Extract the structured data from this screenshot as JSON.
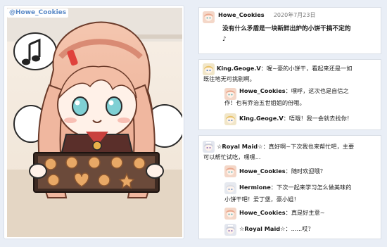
{
  "post": {
    "tag": "@Howe_Cookies"
  },
  "thread1": {
    "author": "Howe_Cookies",
    "date": "2020年7月23日",
    "text_line1": "没有什么矛盾是一块新鲜出炉的小饼干搞不定的",
    "text_line2": "♪"
  },
  "thread2": {
    "comment": {
      "author": "King.Geoge.V",
      "sep": "：",
      "text_line1": "喔~豪的小饼干，看起来还是一如",
      "text_line2": "既往地无可挑剔啊。"
    },
    "replies": [
      {
        "author": "Howe_Cookies",
        "sep": "：",
        "text_line1": "嘿呼，这次也是自信之",
        "text_line2": "作！也有乔治五世姐姐的份哦。"
      },
      {
        "author": "King.Geoge.V",
        "sep": "：",
        "text_line1": "唔哦！我一会就去找你！",
        "text_line2": ""
      }
    ]
  },
  "thread3": {
    "comment": {
      "author": "☆Royal Maid☆",
      "sep": "：",
      "text_line1": "真好啊~下次我也来帮忙吧，主要",
      "text_line2": "可以帮忙试吃，嘿嘿..."
    },
    "replies": [
      {
        "author": "Howe_Cookies",
        "sep": "：",
        "text_line1": "随时欢迎哦？",
        "text_line2": ""
      },
      {
        "author": "Hermione",
        "sep": "：",
        "text_line1": "下次一起来学习怎么做美味的",
        "text_line2": "小饼干吧！爱丁堡，豪小姐！"
      },
      {
        "author": "Howe_Cookies",
        "sep": "：",
        "text_line1": "真是好主意~",
        "text_line2": ""
      },
      {
        "author": "☆Royal Maid☆",
        "sep": "：",
        "text_line1": "......哎？",
        "text_line2": ""
      }
    ]
  },
  "colors": {
    "page_bg": "#e9eef6",
    "tag_text": "#5b8ac7",
    "card_border": "#d9dee6"
  },
  "icons": [
    "howe-avatar-icon",
    "king-george-avatar-icon",
    "royal-maid-avatar-icon",
    "hermione-avatar-icon",
    "music-note-icon"
  ]
}
